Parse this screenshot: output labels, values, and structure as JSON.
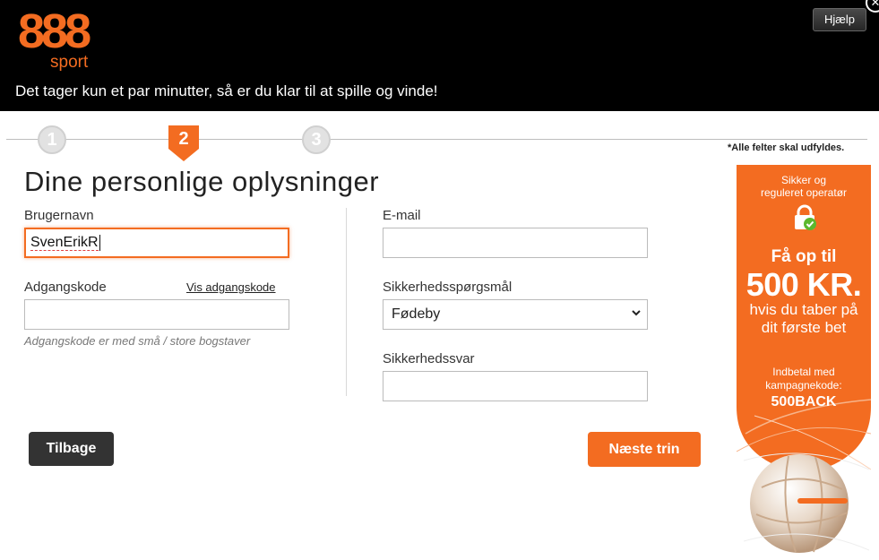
{
  "header": {
    "logo_number": "888",
    "logo_sub": "sport",
    "tagline": "Det tager kun et par minutter, så er du klar til at spille og vinde!",
    "help_label": "Hjælp",
    "close_label": "✕"
  },
  "steps": {
    "items": [
      "1",
      "2",
      "3"
    ],
    "active": 2,
    "required_note": "*Alle felter skal udfyldes."
  },
  "form": {
    "title": "Dine personlige oplysninger",
    "username_label": "Brugernavn",
    "username_value": "SvenErikR",
    "password_label": "Adgangskode",
    "show_password_label": "Vis adgangskode",
    "password_value": "",
    "password_hint": "Adgangskode er med små / store bogstaver",
    "email_label": "E-mail",
    "email_value": "",
    "security_question_label": "Sikkerhedsspørgsmål",
    "security_question_value": "Fødeby",
    "security_answer_label": "Sikkerhedssvar",
    "security_answer_value": ""
  },
  "buttons": {
    "back_label": "Tilbage",
    "next_label": "Næste trin"
  },
  "promo": {
    "safe_line1": "Sikker og",
    "safe_line2": "reguleret operatør",
    "up_to": "Få op til",
    "amount": "500 KR.",
    "lose_line1": "hvis du taber på",
    "lose_line2": "dit første bet",
    "deposit_line1": "Indbetal med",
    "deposit_line2": "kampagnekode:",
    "code": "500BACK"
  },
  "colors": {
    "brand_orange": "#f36c21",
    "header_bg": "#000000",
    "dark_button": "#333333"
  },
  "icons": {
    "lock": "padlock-check-icon",
    "chevron": "chevron-down-icon",
    "close": "close-icon"
  }
}
